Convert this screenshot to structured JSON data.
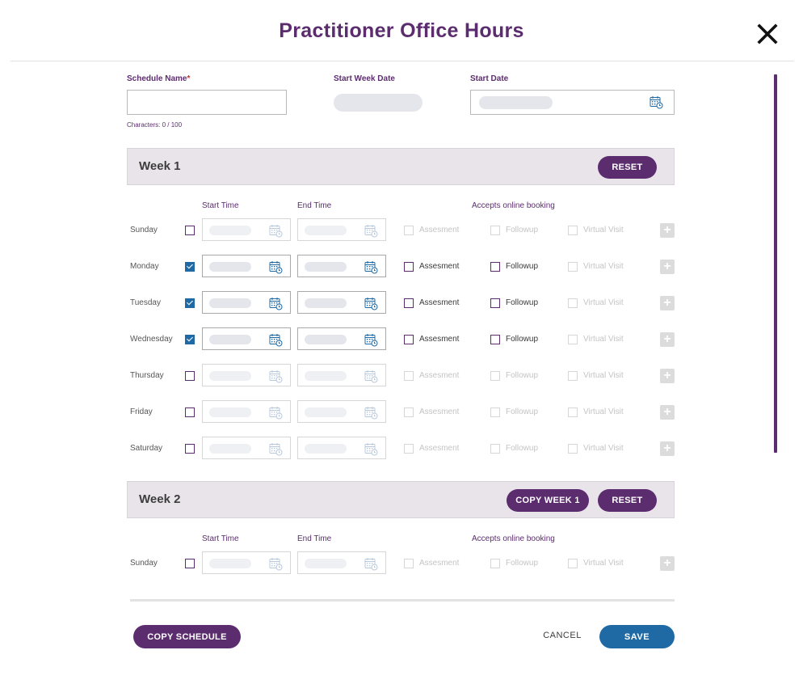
{
  "header": {
    "title": "Practitioner Office Hours",
    "close_icon": "close-icon"
  },
  "form": {
    "schedule_name": {
      "label": "Schedule Name",
      "required_mark": "*",
      "value": "",
      "char_count": "Characters: 0 / 100"
    },
    "start_week_date": {
      "label": "Start Week Date"
    },
    "start_date": {
      "label": "Start Date",
      "icon": "calendar-icon"
    }
  },
  "columns": {
    "start_time": "Start Time",
    "end_time": "End Time",
    "accepts_online_booking": "Accepts online booking"
  },
  "options": {
    "assessment": "Assesment",
    "followup": "Followup",
    "virtual_visit": "Virtual Visit"
  },
  "weeks": [
    {
      "title": "Week 1",
      "reset_label": "RESET",
      "days": [
        {
          "name": "Sunday",
          "enabled": false
        },
        {
          "name": "Monday",
          "enabled": true
        },
        {
          "name": "Tuesday",
          "enabled": true
        },
        {
          "name": "Wednesday",
          "enabled": true
        },
        {
          "name": "Thursday",
          "enabled": false
        },
        {
          "name": "Friday",
          "enabled": false
        },
        {
          "name": "Saturday",
          "enabled": false
        }
      ]
    },
    {
      "title": "Week 2",
      "copy_label": "COPY WEEK 1",
      "reset_label": "RESET",
      "days": [
        {
          "name": "Sunday",
          "enabled": false
        }
      ]
    }
  ],
  "footer": {
    "copy_schedule": "COPY SCHEDULE",
    "cancel": "CANCEL",
    "save": "SAVE"
  },
  "colors": {
    "brand_purple": "#5c2d6e",
    "primary_blue": "#1f6aa5",
    "week_header_bg": "#e9e3ea"
  }
}
